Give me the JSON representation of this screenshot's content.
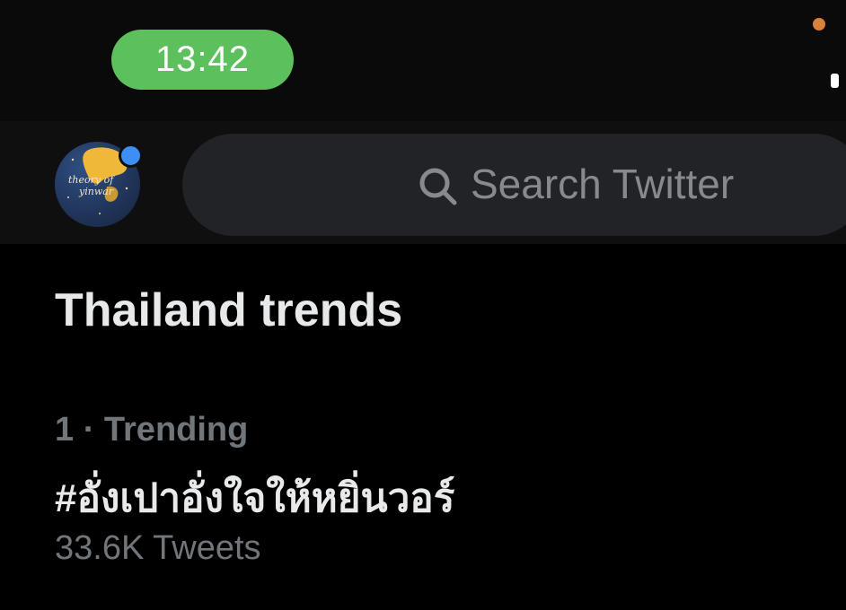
{
  "status_bar": {
    "time": "13:42"
  },
  "header": {
    "avatar_text": [
      "theory of",
      "yinwar"
    ],
    "search_placeholder": "Search Twitter"
  },
  "section": {
    "title": "Thailand trends"
  },
  "trends": [
    {
      "meta": "1 · Trending",
      "name": "#อั่งเปาอั่งใจให้หยิ่นวอร์",
      "count": "33.6K Tweets"
    }
  ],
  "colors": {
    "time_pill": "#5cc15d",
    "privacy_dot": "#d9823b",
    "badge": "#3d8ff5",
    "search_bg": "#222326",
    "muted_text": "#71767b"
  }
}
